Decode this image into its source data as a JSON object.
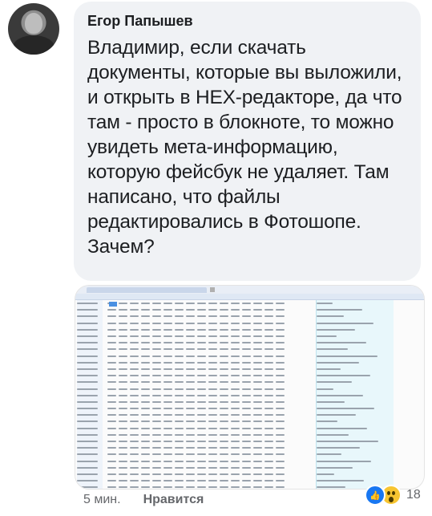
{
  "comment": {
    "author": "Егор Папышев",
    "text": "Владимир, если скачать документы, которые вы выложили, и открыть в HEX-редакторе, да что там - просто в блокноте, то можно увидеть мета-информацию, которую фейсбук не удаляет. Там написано, что файлы редактировались в Фотошопе. Зачем?",
    "time": "5 мин.",
    "like_label": "Нравится",
    "reaction_count": "18",
    "reaction_icons": [
      "like-icon",
      "wow-icon"
    ]
  },
  "attachment": {
    "kind": "hex-editor-screenshot",
    "rows": 31
  },
  "colors": {
    "bubble": "#f0f2f5",
    "like_blue": "#1877f2",
    "wow_yellow": "#f7c531",
    "meta_text": "#65676b"
  }
}
